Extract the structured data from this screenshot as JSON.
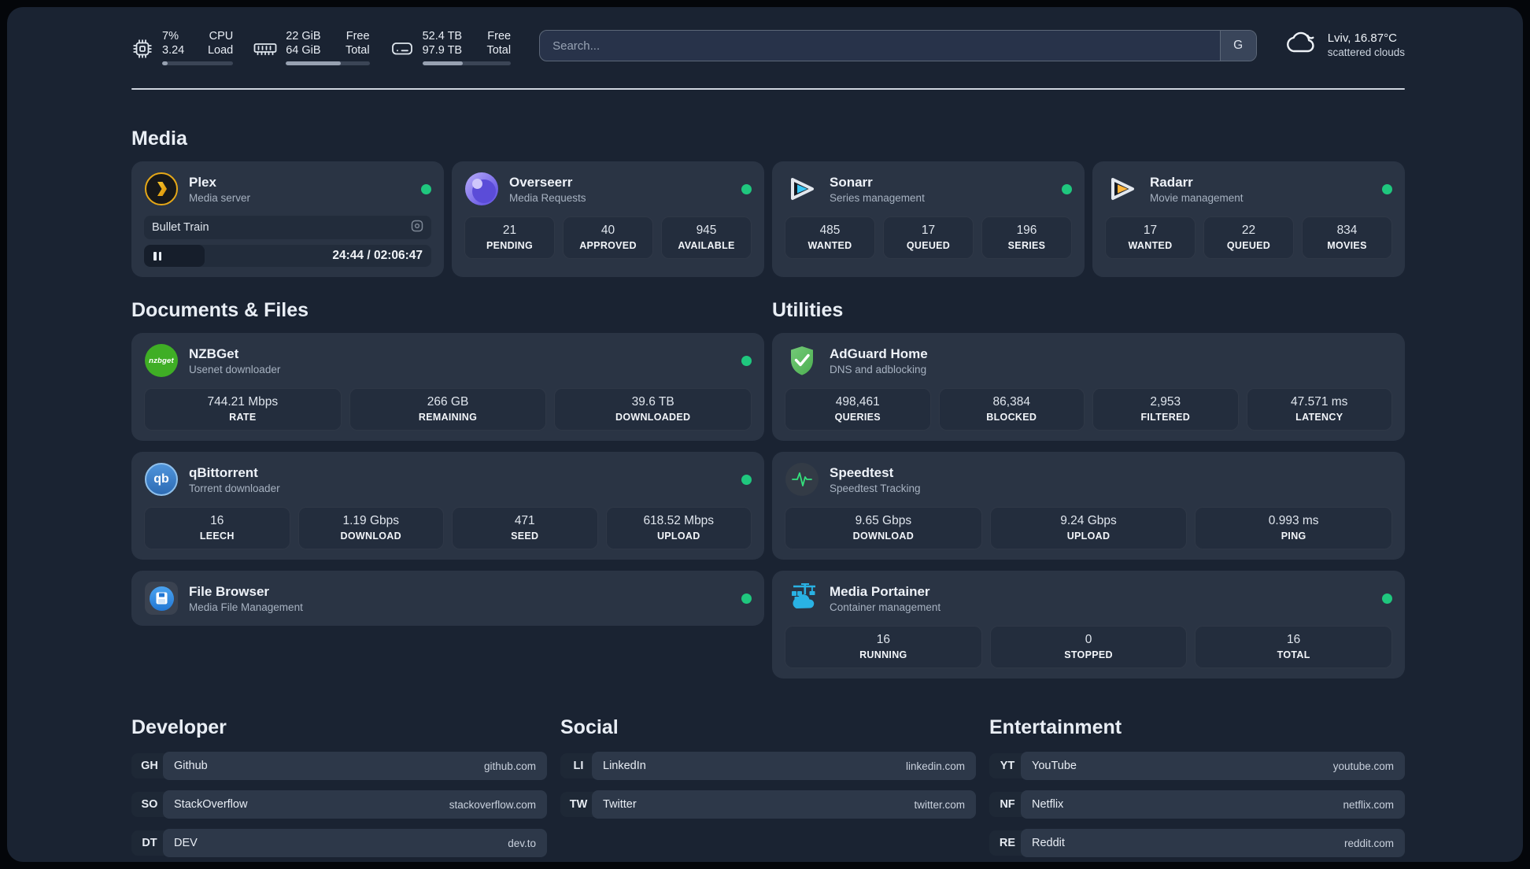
{
  "colors": {
    "status_online": "#1fc77e",
    "plex_gold": "#e6a817",
    "sonarr_blue": "#38c6f4",
    "radarr_yellow": "#ffb53c",
    "nzbget_green": "#3fae25",
    "adguard_green": "#5ab95e",
    "qbittorrent_blue": "#3d78c0",
    "portainer_blue": "#29b2e4",
    "speedtest_pulse": "#35e07c"
  },
  "topbar": {
    "widgets": [
      {
        "name": "cpu",
        "icon": "cpu-chip-icon",
        "col1": [
          "7%",
          "3.24"
        ],
        "col2": [
          "CPU",
          "Load"
        ],
        "progress_pct": 8
      },
      {
        "name": "memory",
        "icon": "ram-stick-icon",
        "col1": [
          "22 GiB",
          "64 GiB"
        ],
        "col2": [
          "Free",
          "Total"
        ],
        "progress_pct": 66
      },
      {
        "name": "storage",
        "icon": "hard-drive-icon",
        "col1": [
          "52.4 TB",
          "97.9 TB"
        ],
        "col2": [
          "Free",
          "Total"
        ],
        "progress_pct": 46
      }
    ],
    "search": {
      "placeholder": "Search...",
      "engine_button": "G"
    },
    "weather": {
      "icon": "scattered-clouds-icon",
      "location": "Lviv, 16.87°C",
      "condition": "scattered clouds"
    }
  },
  "media": {
    "heading": "Media",
    "plex": {
      "title": "Plex",
      "subtitle": "Media server",
      "status": "online",
      "now_playing": {
        "title": "Bullet Train",
        "time_display": "24:44 / 02:06:47",
        "progress_pct": 21
      }
    },
    "overseerr": {
      "title": "Overseerr",
      "subtitle": "Media Requests",
      "status": "online",
      "stats": [
        {
          "value": "21",
          "label": "PENDING"
        },
        {
          "value": "40",
          "label": "APPROVED"
        },
        {
          "value": "945",
          "label": "AVAILABLE"
        }
      ]
    },
    "sonarr": {
      "title": "Sonarr",
      "subtitle": "Series management",
      "status": "online",
      "stats": [
        {
          "value": "485",
          "label": "WANTED"
        },
        {
          "value": "17",
          "label": "QUEUED"
        },
        {
          "value": "196",
          "label": "SERIES"
        }
      ]
    },
    "radarr": {
      "title": "Radarr",
      "subtitle": "Movie management",
      "status": "online",
      "stats": [
        {
          "value": "17",
          "label": "WANTED"
        },
        {
          "value": "22",
          "label": "QUEUED"
        },
        {
          "value": "834",
          "label": "MOVIES"
        }
      ]
    }
  },
  "documents": {
    "heading": "Documents & Files",
    "nzbget": {
      "title": "NZBGet",
      "subtitle": "Usenet downloader",
      "status": "online",
      "stats": [
        {
          "value": "744.21 Mbps",
          "label": "RATE"
        },
        {
          "value": "266 GB",
          "label": "REMAINING"
        },
        {
          "value": "39.6 TB",
          "label": "DOWNLOADED"
        }
      ]
    },
    "qbittorrent": {
      "title": "qBittorrent",
      "subtitle": "Torrent downloader",
      "status": "online",
      "stats": [
        {
          "value": "16",
          "label": "LEECH"
        },
        {
          "value": "1.19 Gbps",
          "label": "DOWNLOAD"
        },
        {
          "value": "471",
          "label": "SEED"
        },
        {
          "value": "618.52 Mbps",
          "label": "UPLOAD"
        }
      ]
    },
    "filebrowser": {
      "title": "File Browser",
      "subtitle": "Media File Management",
      "status": "online"
    }
  },
  "utilities": {
    "heading": "Utilities",
    "adguard": {
      "title": "AdGuard Home",
      "subtitle": "DNS and adblocking",
      "stats": [
        {
          "value": "498,461",
          "label": "QUERIES"
        },
        {
          "value": "86,384",
          "label": "BLOCKED"
        },
        {
          "value": "2,953",
          "label": "FILTERED"
        },
        {
          "value": "47.571 ms",
          "label": "LATENCY"
        }
      ]
    },
    "speedtest": {
      "title": "Speedtest",
      "subtitle": "Speedtest Tracking",
      "stats": [
        {
          "value": "9.65 Gbps",
          "label": "DOWNLOAD"
        },
        {
          "value": "9.24 Gbps",
          "label": "UPLOAD"
        },
        {
          "value": "0.993 ms",
          "label": "PING"
        }
      ]
    },
    "portainer": {
      "title": "Media Portainer",
      "subtitle": "Container management",
      "status": "online",
      "stats": [
        {
          "value": "16",
          "label": "RUNNING"
        },
        {
          "value": "0",
          "label": "STOPPED"
        },
        {
          "value": "16",
          "label": "TOTAL"
        }
      ]
    }
  },
  "bookmarks": [
    {
      "heading": "Developer",
      "items": [
        {
          "tag": "GH",
          "name": "Github",
          "url": "github.com"
        },
        {
          "tag": "SO",
          "name": "StackOverflow",
          "url": "stackoverflow.com"
        },
        {
          "tag": "DT",
          "name": "DEV",
          "url": "dev.to"
        }
      ]
    },
    {
      "heading": "Social",
      "items": [
        {
          "tag": "LI",
          "name": "LinkedIn",
          "url": "linkedin.com"
        },
        {
          "tag": "TW",
          "name": "Twitter",
          "url": "twitter.com"
        }
      ]
    },
    {
      "heading": "Entertainment",
      "items": [
        {
          "tag": "YT",
          "name": "YouTube",
          "url": "youtube.com"
        },
        {
          "tag": "NF",
          "name": "Netflix",
          "url": "netflix.com"
        },
        {
          "tag": "RE",
          "name": "Reddit",
          "url": "reddit.com"
        }
      ]
    }
  ]
}
